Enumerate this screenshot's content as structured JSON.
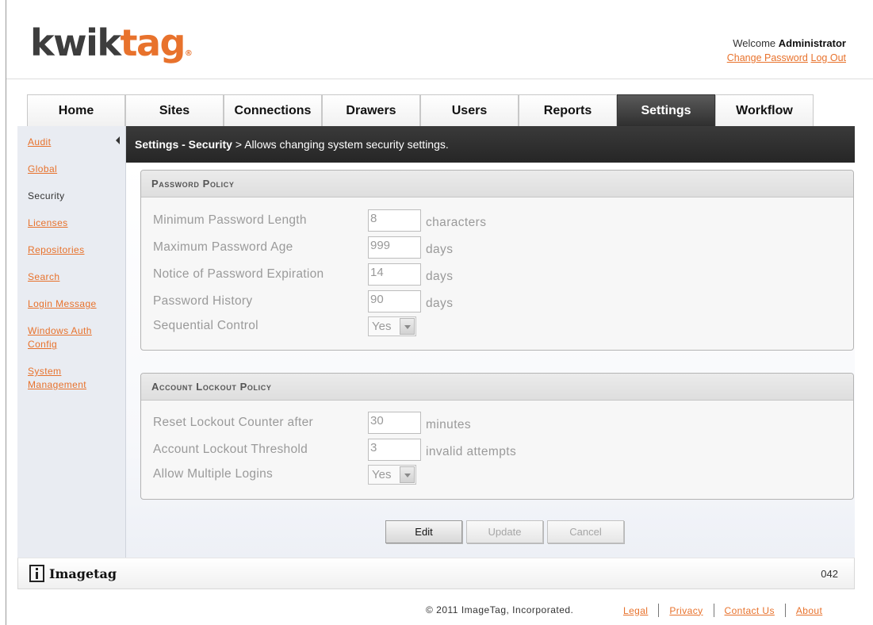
{
  "brand": {
    "part1": "kwik",
    "part2": "tag",
    "reg": "®"
  },
  "user": {
    "welcome_prefix": "Welcome",
    "name": "Administrator",
    "change_password": "Change Password",
    "log_out": "Log Out"
  },
  "tabs": [
    {
      "label": "Home",
      "active": false
    },
    {
      "label": "Sites",
      "active": false
    },
    {
      "label": "Connections",
      "active": false
    },
    {
      "label": "Drawers",
      "active": false
    },
    {
      "label": "Users",
      "active": false
    },
    {
      "label": "Reports",
      "active": false
    },
    {
      "label": "Settings",
      "active": true
    },
    {
      "label": "Workflow",
      "active": false
    }
  ],
  "sidebar": {
    "items": [
      {
        "label": "Audit",
        "current": false
      },
      {
        "label": "Global",
        "current": false
      },
      {
        "label": "Security",
        "current": true
      },
      {
        "label": "Licenses",
        "current": false
      },
      {
        "label": "Repositories",
        "current": false
      },
      {
        "label": "Search",
        "current": false
      },
      {
        "label": "Login Message",
        "current": false
      },
      {
        "label": "Windows Auth Config",
        "current": false
      },
      {
        "label": "System Management",
        "current": false
      }
    ]
  },
  "titlebar": {
    "title": "Settings - Security",
    "description": "> Allows changing system security settings."
  },
  "password_policy": {
    "title": "Password Policy",
    "rows": [
      {
        "label": "Minimum Password Length",
        "value": "8",
        "unit": "characters"
      },
      {
        "label": "Maximum Password Age",
        "value": "999",
        "unit": "days"
      },
      {
        "label": "Notice of Password Expiration",
        "value": "14",
        "unit": "days"
      },
      {
        "label": "Password History",
        "value": "90",
        "unit": "days"
      }
    ],
    "sequential_label": "Sequential Control",
    "sequential_value": "Yes"
  },
  "lockout_policy": {
    "title": "Account Lockout Policy",
    "rows": [
      {
        "label": "Reset Lockout Counter after",
        "value": "30",
        "unit": "minutes"
      },
      {
        "label": "Account Lockout Threshold",
        "value": "3",
        "unit": "invalid attempts"
      }
    ],
    "multiple_label": "Allow Multiple Logins",
    "multiple_value": "Yes"
  },
  "actions": {
    "edit": "Edit",
    "update": "Update",
    "cancel": "Cancel"
  },
  "footer": {
    "imagetag": "Imagetag",
    "code": "042",
    "copyright": "© 2011 ImageTag, Incorporated.",
    "links": [
      "Legal",
      "Privacy",
      "Contact Us",
      "About"
    ]
  },
  "colors": {
    "accent": "#e8722c",
    "titlebar": "#2f2f2f"
  }
}
